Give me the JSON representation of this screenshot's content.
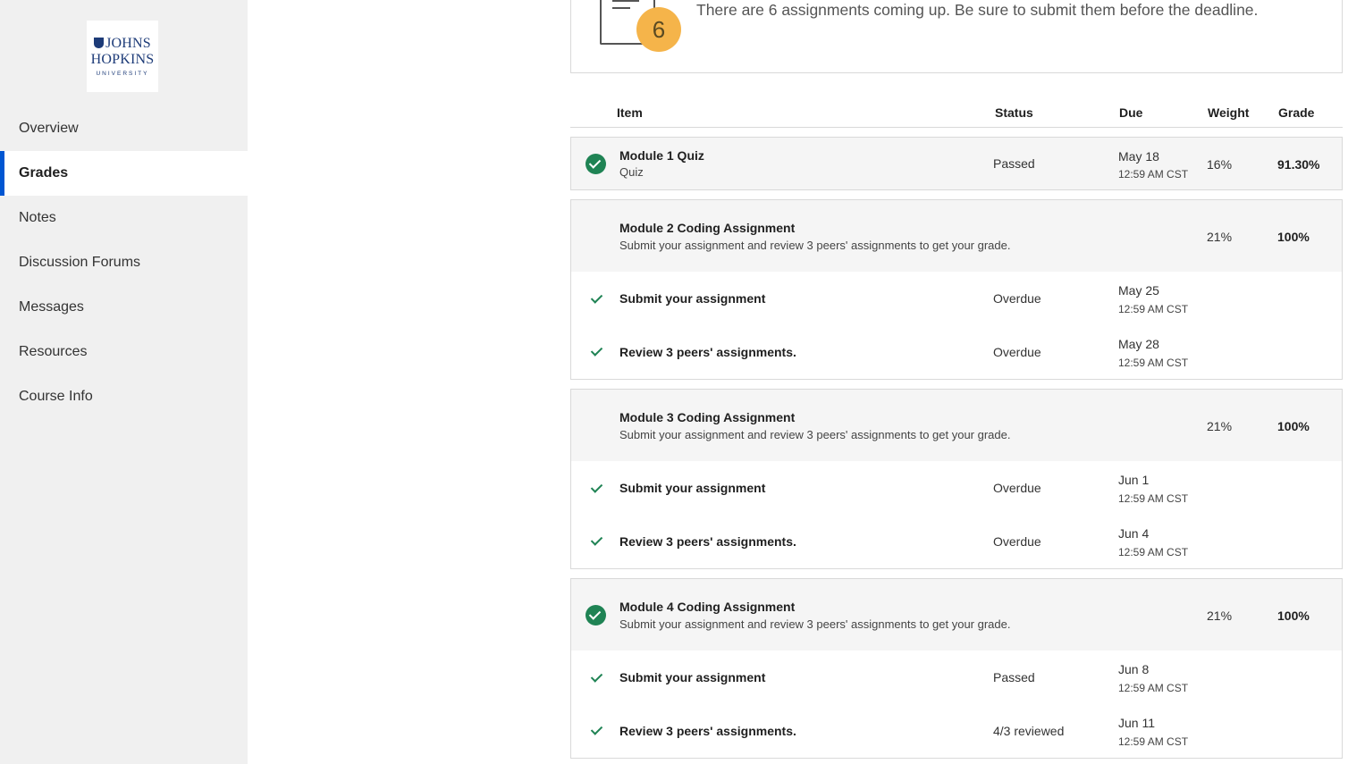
{
  "sidebar": {
    "logo": {
      "line1": "JOHNS",
      "line2": "HOPKINS",
      "line3": "UNIVERSITY"
    },
    "items": [
      {
        "label": "Overview"
      },
      {
        "label": "Grades"
      },
      {
        "label": "Notes"
      },
      {
        "label": "Discussion Forums"
      },
      {
        "label": "Messages"
      },
      {
        "label": "Resources"
      },
      {
        "label": "Course Info"
      }
    ],
    "active": "Grades"
  },
  "banner": {
    "count": "6",
    "text": "There are 6 assignments coming up. Be sure to submit them before the deadline."
  },
  "table": {
    "headers": {
      "item": "Item",
      "status": "Status",
      "due": "Due",
      "weight": "Weight",
      "grade": "Grade"
    },
    "groups": [
      {
        "title": "Module 1 Quiz",
        "subtitle": "Quiz",
        "status": "Passed",
        "due_date": "May 18",
        "due_time": "12:59 AM CST",
        "weight": "16%",
        "grade": "91.30%",
        "completed": true,
        "subitems": []
      },
      {
        "title": "Module 2 Coding Assignment",
        "subtitle": "Submit your assignment and review 3 peers' assignments to get your grade.",
        "weight": "21%",
        "grade": "100%",
        "completed": false,
        "subitems": [
          {
            "title": "Submit your assignment",
            "status": "Overdue",
            "due_date": "May 25",
            "due_time": "12:59 AM CST"
          },
          {
            "title": "Review 3 peers' assignments.",
            "status": "Overdue",
            "due_date": "May 28",
            "due_time": "12:59 AM CST"
          }
        ]
      },
      {
        "title": "Module 3 Coding Assignment",
        "subtitle": "Submit your assignment and review 3 peers' assignments to get your grade.",
        "weight": "21%",
        "grade": "100%",
        "completed": false,
        "subitems": [
          {
            "title": "Submit your assignment",
            "status": "Overdue",
            "due_date": "Jun 1",
            "due_time": "12:59 AM CST"
          },
          {
            "title": "Review 3 peers' assignments.",
            "status": "Overdue",
            "due_date": "Jun 4",
            "due_time": "12:59 AM CST"
          }
        ]
      },
      {
        "title": "Module 4 Coding Assignment",
        "subtitle": "Submit your assignment and review 3 peers' assignments to get your grade.",
        "weight": "21%",
        "grade": "100%",
        "completed": true,
        "subitems": [
          {
            "title": "Submit your assignment",
            "status": "Passed",
            "due_date": "Jun 8",
            "due_time": "12:59 AM CST"
          },
          {
            "title": "Review 3 peers' assignments.",
            "status": "4/3 reviewed",
            "due_date": "Jun 11",
            "due_time": "12:59 AM CST"
          }
        ]
      }
    ]
  },
  "colors": {
    "accent": "#0056d2",
    "success": "#1f8354",
    "badge": "#f5b44a"
  }
}
